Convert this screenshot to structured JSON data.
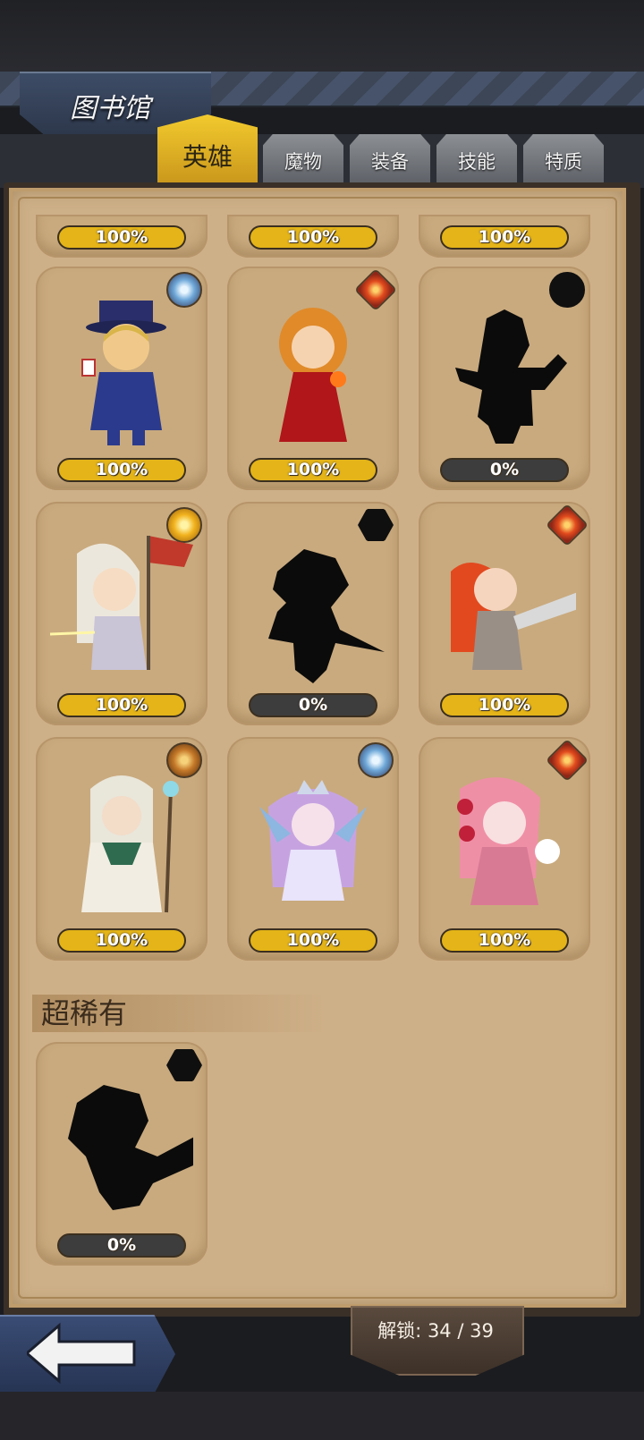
{
  "header": {
    "title": "图书馆"
  },
  "tabs": [
    {
      "label": "英雄",
      "active": true
    },
    {
      "label": "魔物",
      "active": false
    },
    {
      "label": "装备",
      "active": false
    },
    {
      "label": "技能",
      "active": false
    },
    {
      "label": "特质",
      "active": false
    }
  ],
  "cards_top_partial": [
    "100%",
    "100%",
    "100%"
  ],
  "cards": [
    {
      "percent": "100%",
      "element": "water-icon",
      "locked": false
    },
    {
      "percent": "100%",
      "element": "fire-icon",
      "locked": false
    },
    {
      "percent": "0%",
      "element": "dark-icon",
      "locked": true
    },
    {
      "percent": "100%",
      "element": "light-icon",
      "locked": false
    },
    {
      "percent": "0%",
      "element": "dark-icon",
      "locked": true
    },
    {
      "percent": "100%",
      "element": "fire-icon",
      "locked": false
    },
    {
      "percent": "100%",
      "element": "earth-icon",
      "locked": false
    },
    {
      "percent": "100%",
      "element": "water-icon",
      "locked": false
    },
    {
      "percent": "100%",
      "element": "fire-icon",
      "locked": false
    }
  ],
  "section_super_rare": {
    "title": "超稀有"
  },
  "super_rare_cards": [
    {
      "percent": "0%",
      "element": "dark-icon",
      "locked": true
    }
  ],
  "footer": {
    "unlock_label": "解锁: 34 / 39"
  },
  "colors": {
    "accent": "#e4b418",
    "parchment": "#ceb088",
    "locked_bar": "#3d3d3d"
  }
}
